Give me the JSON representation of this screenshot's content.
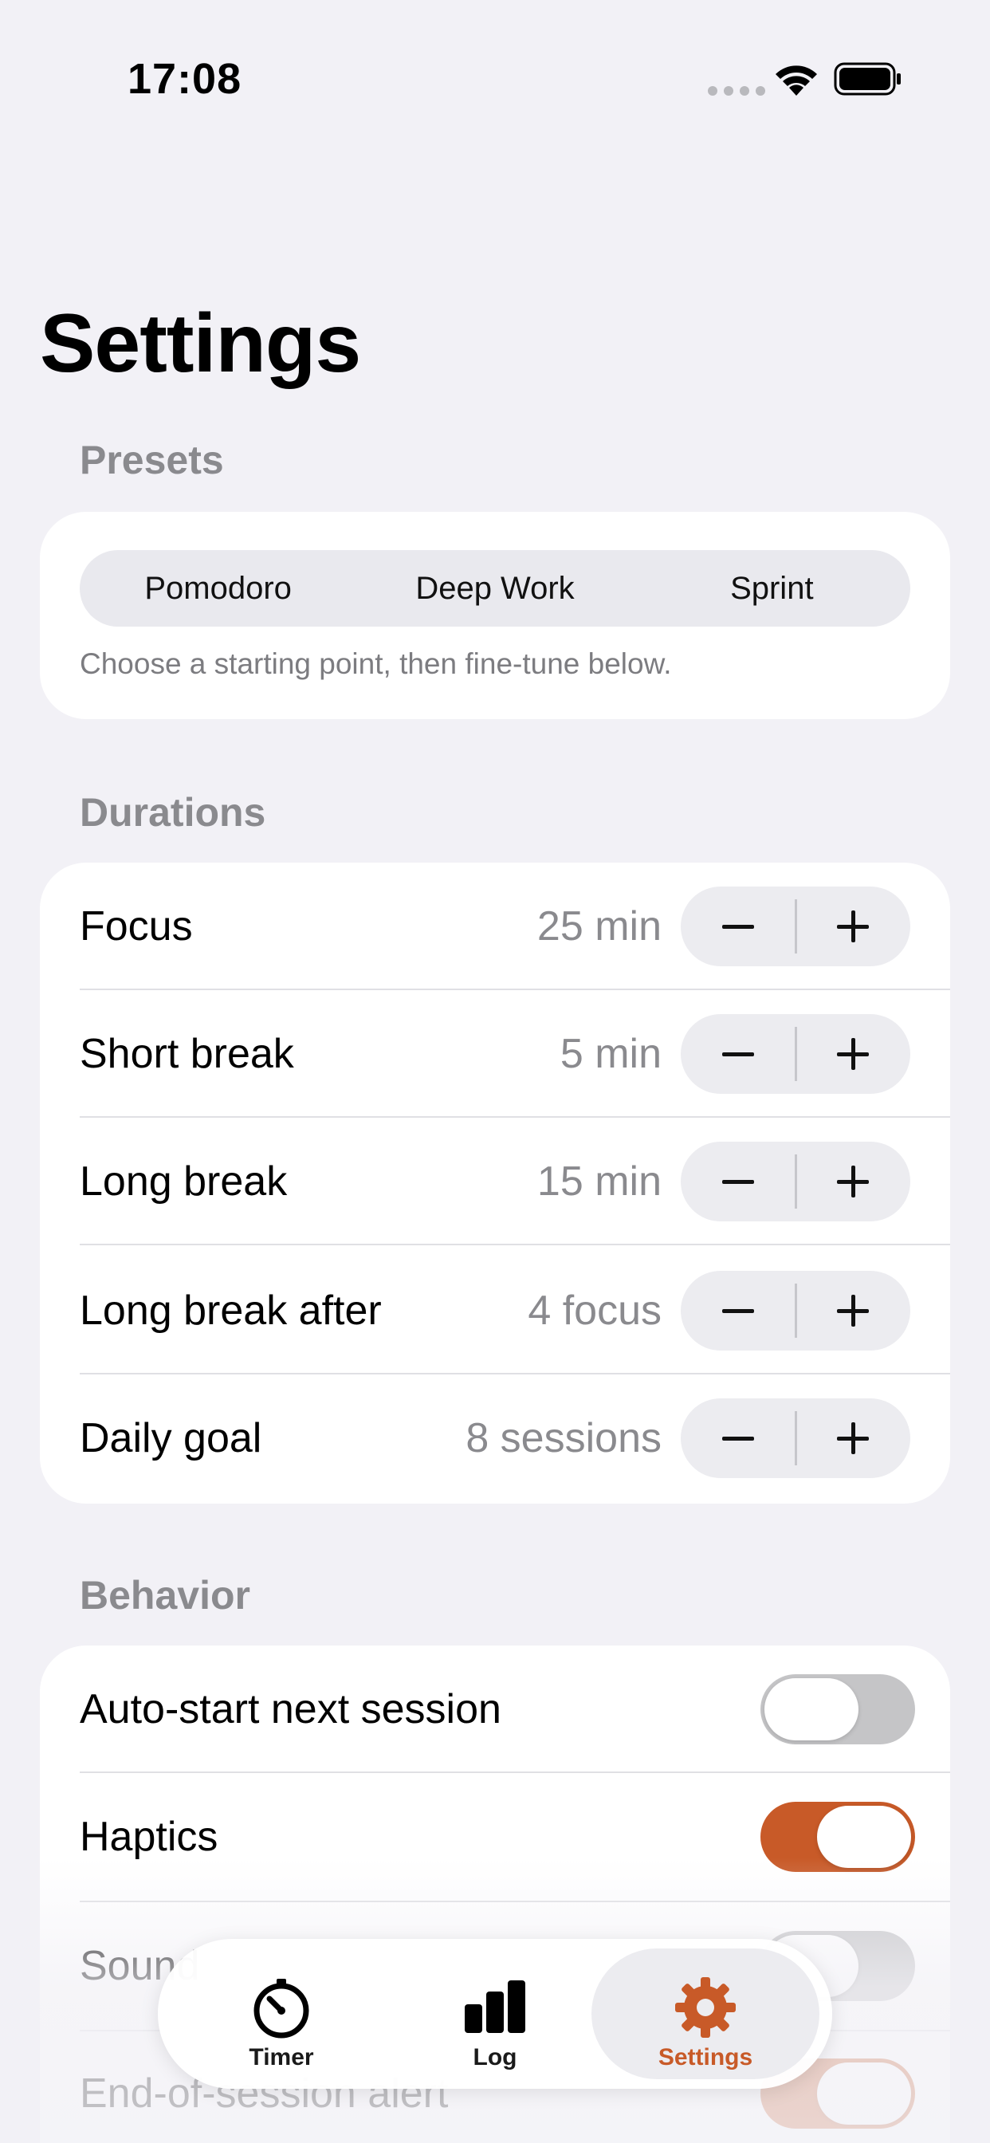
{
  "status_bar": {
    "time": "17:08"
  },
  "page_title": "Settings",
  "presets": {
    "header": "Presets",
    "options": [
      "Pomodoro",
      "Deep Work",
      "Sprint"
    ],
    "helper": "Choose a starting point, then fine-tune below."
  },
  "durations": {
    "header": "Durations",
    "rows": [
      {
        "label": "Focus",
        "value": "25 min"
      },
      {
        "label": "Short break",
        "value": "5 min"
      },
      {
        "label": "Long break",
        "value": "15 min"
      },
      {
        "label": "Long break after",
        "value": "4 focus"
      },
      {
        "label": "Daily goal",
        "value": "8 sessions"
      }
    ]
  },
  "behavior": {
    "header": "Behavior",
    "rows": [
      {
        "label": "Auto-start next session",
        "on": false
      },
      {
        "label": "Haptics",
        "on": true
      },
      {
        "label": "Sound",
        "on": false
      },
      {
        "label": "End-of-session alert",
        "on": true
      }
    ]
  },
  "tab_bar": {
    "tabs": [
      {
        "label": "Timer",
        "icon": "timer-icon"
      },
      {
        "label": "Log",
        "icon": "bar-chart-icon"
      },
      {
        "label": "Settings",
        "icon": "gear-icon",
        "active": true
      }
    ]
  },
  "colors": {
    "accent": "#c85a28",
    "background": "#f2f1f6",
    "secondary_text": "#8a8a8e"
  }
}
